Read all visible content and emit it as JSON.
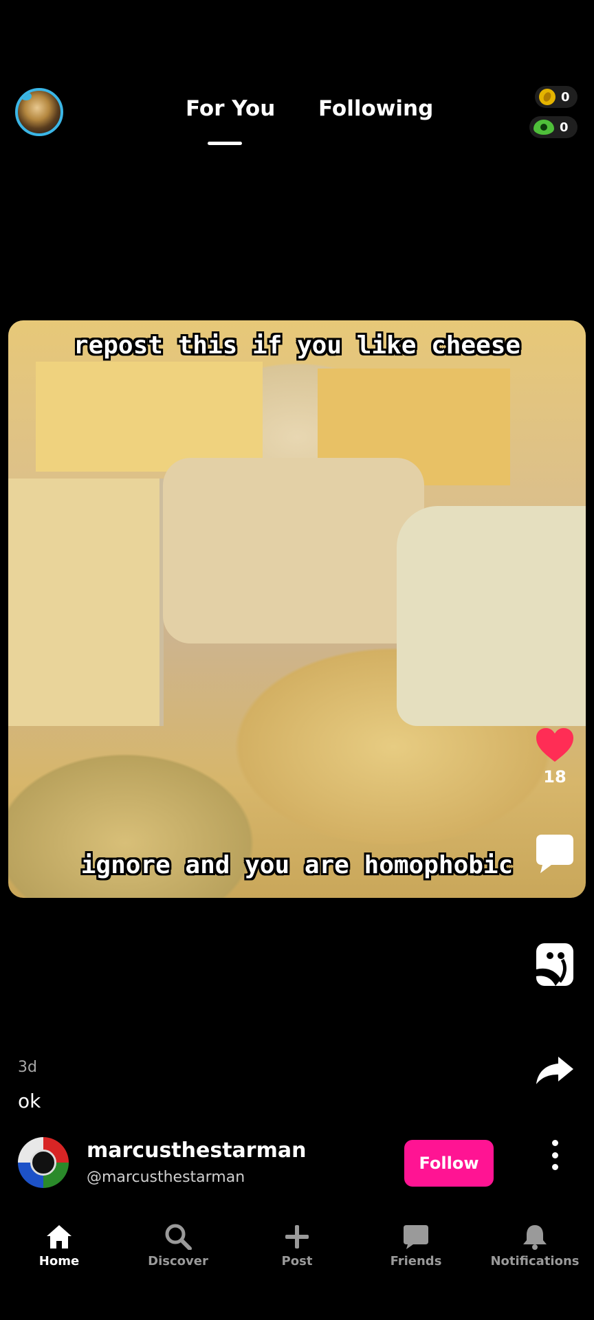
{
  "header": {
    "tabs": [
      {
        "label": "For You",
        "active": true
      },
      {
        "label": "Following",
        "active": false
      }
    ],
    "coins": [
      {
        "icon": "gold-coin-icon",
        "count": "0"
      },
      {
        "icon": "green-gem-icon",
        "count": "0"
      }
    ]
  },
  "post": {
    "caption_top": "repost this if you like cheese",
    "caption_bottom": "ignore and you are homophobic",
    "likes": "18",
    "time": "3d",
    "text": "ok",
    "author": {
      "name": "marcusthestarman",
      "handle": "@marcusthestarman"
    },
    "follow_label": "Follow"
  },
  "nav": [
    {
      "label": "Home",
      "icon": "home-icon",
      "active": true
    },
    {
      "label": "Discover",
      "icon": "search-icon",
      "active": false
    },
    {
      "label": "Post",
      "icon": "plus-icon",
      "active": false
    },
    {
      "label": "Friends",
      "icon": "chat-icon",
      "active": false
    },
    {
      "label": "Notifications",
      "icon": "bell-icon",
      "active": false
    }
  ],
  "colors": {
    "accent": "#ff1493",
    "like": "#ff2d55",
    "avatar_ring": "#3bb6e6",
    "background": "#000000"
  }
}
